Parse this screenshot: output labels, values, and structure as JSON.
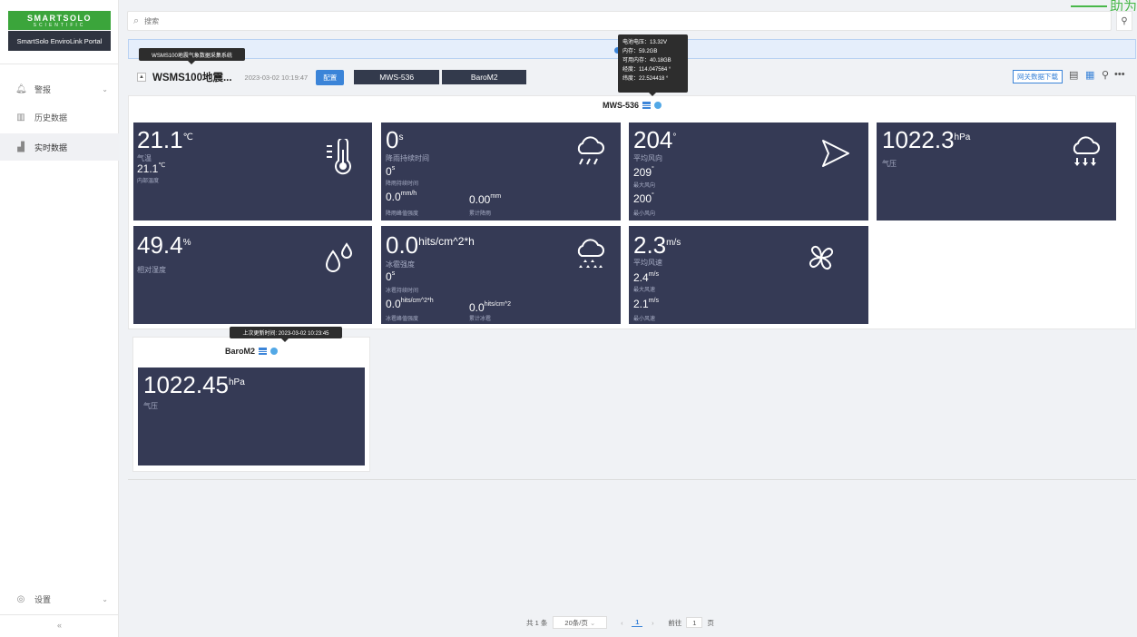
{
  "sidebar": {
    "logo_line1": "SMARTSOLO",
    "logo_line2": "SCIENTIFIC",
    "portal": "SmartSolo EnviroLink Portal",
    "items": [
      {
        "label": "警报"
      },
      {
        "label": "历史数据"
      },
      {
        "label": "实时数据"
      }
    ],
    "settings": "设置",
    "collapse": "«"
  },
  "search": {
    "placeholder": "搜索"
  },
  "top_corner_text": "助为",
  "tooltips": {
    "system_name": "WSMS100地震气象数据采集系统",
    "device_info": [
      "电池电压：13.32V",
      "内存：59.2GB",
      "可用内存：40.18GB",
      "经度：114.047564 °",
      "纬度：22.524418 °"
    ],
    "last_update": "上次更新时间: 2023-03-02 10:23:45"
  },
  "station": {
    "title": "WSMS100地震...",
    "time": "2023-03-02 10:19:47",
    "config_label": "配置",
    "tabs": [
      "MWS-536",
      "BaroM2"
    ],
    "gateway_download": "网关数据下载"
  },
  "mws": {
    "title": "MWS-536",
    "temp": {
      "value": "21.1",
      "unit": "℃",
      "label": "气温",
      "inner_value": "21.1",
      "inner_unit": "℃",
      "inner_label": "内部温度"
    },
    "rain": {
      "value": "0",
      "unit": "s",
      "label": "降雨持续时间",
      "v2": "0",
      "v2_unit": "s",
      "v2_label": "降雨持续时间",
      "v3": "0.0",
      "v3_unit": "mm/h",
      "v3_label": "降雨峰值强度",
      "v4": "0.00",
      "v4_unit": "mm",
      "v4_label": "累计降雨"
    },
    "wind_dir": {
      "value": "204",
      "unit": "°",
      "label": "平均风向",
      "v2": "209",
      "v2_unit": "°",
      "v2_label": "最大风向",
      "v3": "200",
      "v3_unit": "°",
      "v3_label": "最小风向"
    },
    "pressure": {
      "value": "1022.3",
      "unit": "hPa",
      "label": "气压"
    },
    "humidity": {
      "value": "49.4",
      "unit": "%",
      "label": "相对湿度"
    },
    "hail": {
      "value": "0.0",
      "unit": "hits/cm^2*h",
      "label": "冰雹强度",
      "v2": "0",
      "v2_unit": "s",
      "v2_label": "冰雹持续时间",
      "v3": "0.0",
      "v3_unit": "hits/cm^2*h",
      "v3_label": "冰雹峰值强度",
      "v4": "0.0",
      "v4_unit": "hits/cm^2",
      "v4_label": "累计冰雹"
    },
    "wind_speed": {
      "value": "2.3",
      "unit": "m/s",
      "label": "平均风速",
      "v2": "2.4",
      "v2_unit": "m/s",
      "v2_label": "最大风速",
      "v3": "2.1",
      "v3_unit": "m/s",
      "v3_label": "最小风速"
    }
  },
  "baro": {
    "title": "BaroM2",
    "pressure": {
      "value": "1022.45",
      "unit": "hPa",
      "label": "气压"
    }
  },
  "pager": {
    "total": "共 1 条",
    "page_size": "20条/页",
    "prev": "‹",
    "current": "1",
    "next": "›",
    "goto": "前往",
    "goto_value": "1",
    "unit": "页"
  },
  "colors": {
    "card_bg": "#353a55",
    "accent": "#3b84d8",
    "logo_green": "#3ba53b"
  }
}
